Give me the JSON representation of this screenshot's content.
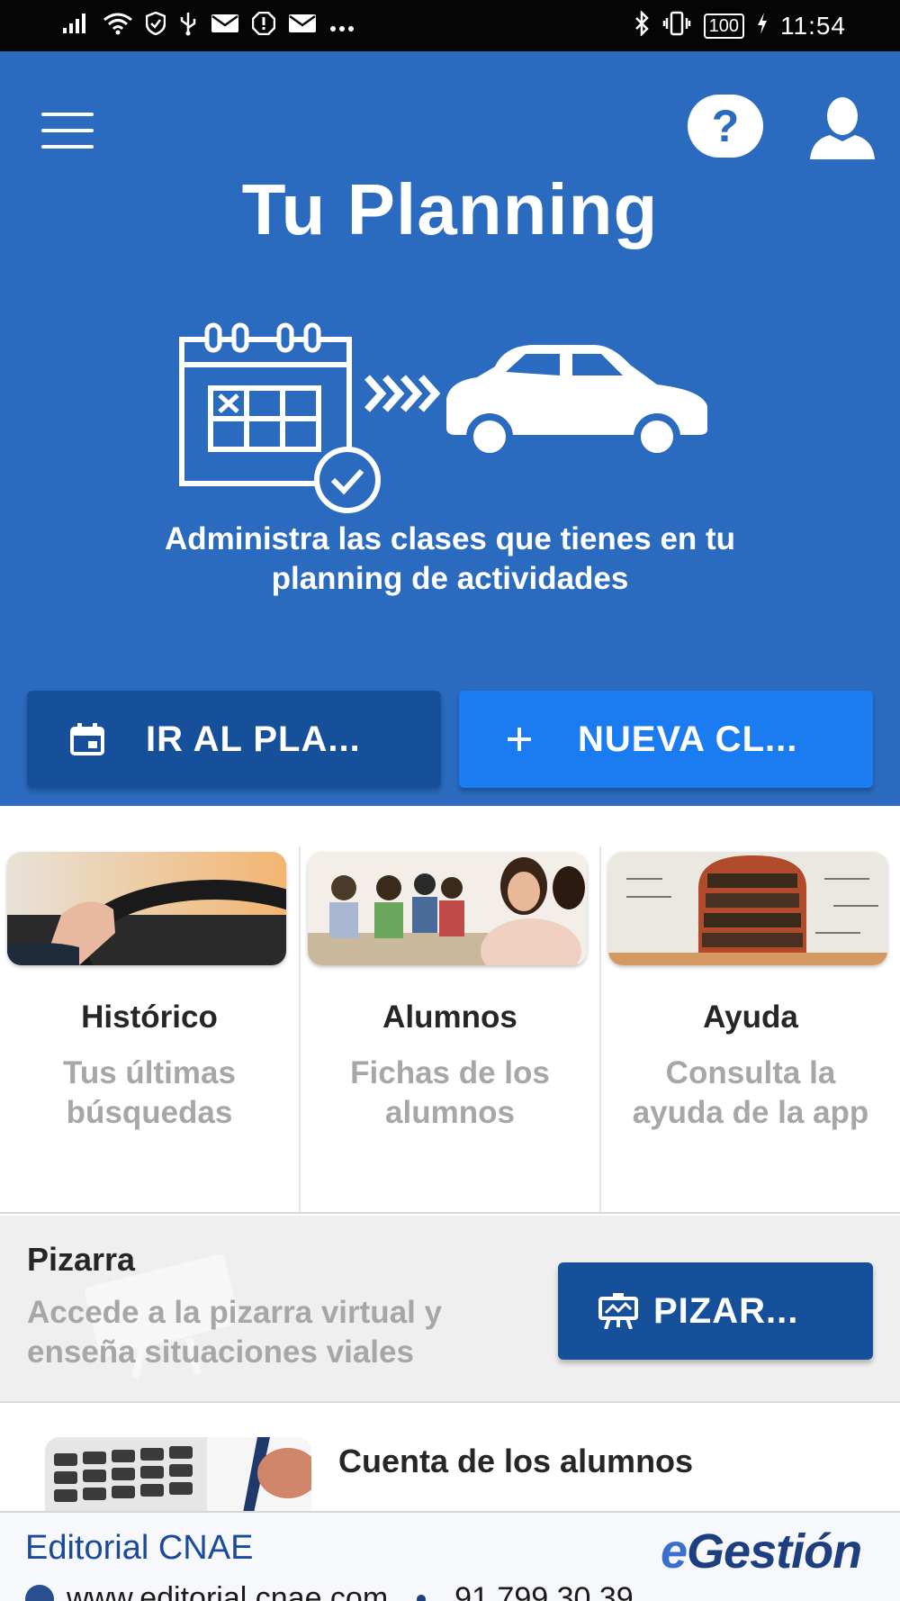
{
  "status_bar": {
    "left_icons": [
      "signal-icon",
      "wifi-icon",
      "shield-icon",
      "usb-icon",
      "mail-icon",
      "alert-icon",
      "mail-icon",
      "more-icon"
    ],
    "right_icons": [
      "bluetooth-icon",
      "vibrate-icon"
    ],
    "battery": "100",
    "time": "11:54"
  },
  "hero": {
    "title": "Tu Planning",
    "subtitle": "Administra las clases que tienes en tu planning de actividades",
    "help_label": "?",
    "buttons": {
      "plan_label": "IR AL PLA...",
      "new_label": "NUEVA CL..."
    }
  },
  "cards": [
    {
      "title": "Histórico",
      "desc": "Tus últimas búsquedas",
      "image": "steering-wheel-photo"
    },
    {
      "title": "Alumnos",
      "desc": "Fichas de los alumnos",
      "image": "students-photo"
    },
    {
      "title": "Ayuda",
      "desc": "Consulta la ayuda de la app",
      "image": "bookshelf-head-photo"
    }
  ],
  "pizarra": {
    "title": "Pizarra",
    "desc": "Accede a la pizarra virtual y enseña situaciones viales",
    "button_label": "PIZAR..."
  },
  "cuenta": {
    "title": "Cuenta de los alumnos",
    "image": "calculator-photo"
  },
  "footer": {
    "brand": "Editorial CNAE",
    "logo_e": "e",
    "logo_rest": "Gestión",
    "website": "www.editorial.cnae.com",
    "phone": "91 799 30 39"
  },
  "colors": {
    "hero_bg": "#2a6bc0",
    "btn_dark": "#16509b",
    "btn_bright": "#1b7cf2"
  }
}
